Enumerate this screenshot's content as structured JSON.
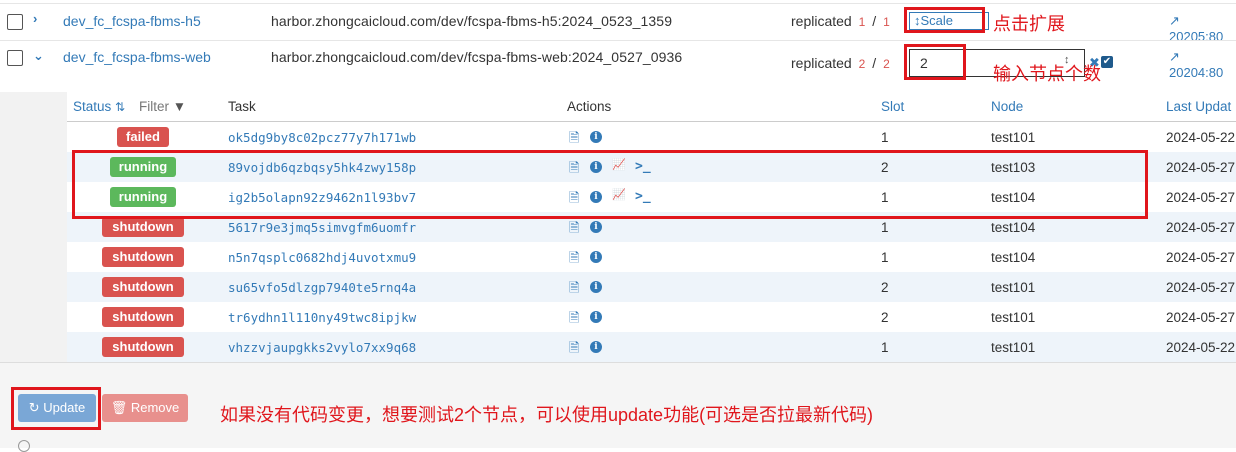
{
  "services": [
    {
      "name": "dev_fc_fcspa-fbms-h5",
      "image": "harbor.zhongcaicloud.com/dev/fcspa-fbms-h5:2024_0523_1359",
      "mode": "replicated",
      "running": "1",
      "desired": "1",
      "scale_label": "Scale",
      "port": "20205:80"
    },
    {
      "name": "dev_fc_fcspa-fbms-web",
      "image": "harbor.zhongcaicloud.com/dev/fcspa-fbms-web:2024_0527_0936",
      "mode": "replicated",
      "running": "2",
      "desired": "2",
      "scale_input_value": "2",
      "port": "20204:80"
    }
  ],
  "annotations": {
    "click_expand": "点击扩展",
    "enter_nodes": "输入节点个数",
    "update_hint": "如果没有代码变更，想要测试2个节点，可以使用update功能(可选是否拉最新代码)"
  },
  "tasks_table": {
    "headers": {
      "status": "Status",
      "filter": "Filter",
      "task": "Task",
      "actions": "Actions",
      "slot": "Slot",
      "node": "Node",
      "last_update": "Last Updat"
    },
    "rows": [
      {
        "status": "failed",
        "task": "ok5dg9by8c02pcz77y7h171wb",
        "slot": "1",
        "node": "test101",
        "updated": "2024-05-22"
      },
      {
        "status": "running",
        "task": "89vojdb6qzbqsy5hk4zwy158p",
        "slot": "2",
        "node": "test103",
        "updated": "2024-05-27"
      },
      {
        "status": "running",
        "task": "ig2b5olapn92z9462n1l93bv7",
        "slot": "1",
        "node": "test104",
        "updated": "2024-05-27"
      },
      {
        "status": "shutdown",
        "task": "5617r9e3jmq5simvgfm6uomfr",
        "slot": "1",
        "node": "test104",
        "updated": "2024-05-27"
      },
      {
        "status": "shutdown",
        "task": "n5n7qsplc0682hdj4uvotxmu9",
        "slot": "1",
        "node": "test104",
        "updated": "2024-05-27"
      },
      {
        "status": "shutdown",
        "task": "su65vfo5dlzgp7940te5rnq4a",
        "slot": "2",
        "node": "test101",
        "updated": "2024-05-27"
      },
      {
        "status": "shutdown",
        "task": "tr6ydhn1l110ny49twc8ipjkw",
        "slot": "2",
        "node": "test101",
        "updated": "2024-05-27"
      },
      {
        "status": "shutdown",
        "task": "vhzzvjaupgkks2vylo7xx9q68",
        "slot": "1",
        "node": "test101",
        "updated": "2024-05-22"
      }
    ]
  },
  "footer": {
    "update_label": "Update",
    "remove_label": "Remove"
  },
  "colors": {
    "link": "#337ab7",
    "annotation_red": "#e0161c",
    "status_failed": "#d9534f",
    "status_running": "#5cb85c",
    "row_alt": "#eef4fa"
  }
}
